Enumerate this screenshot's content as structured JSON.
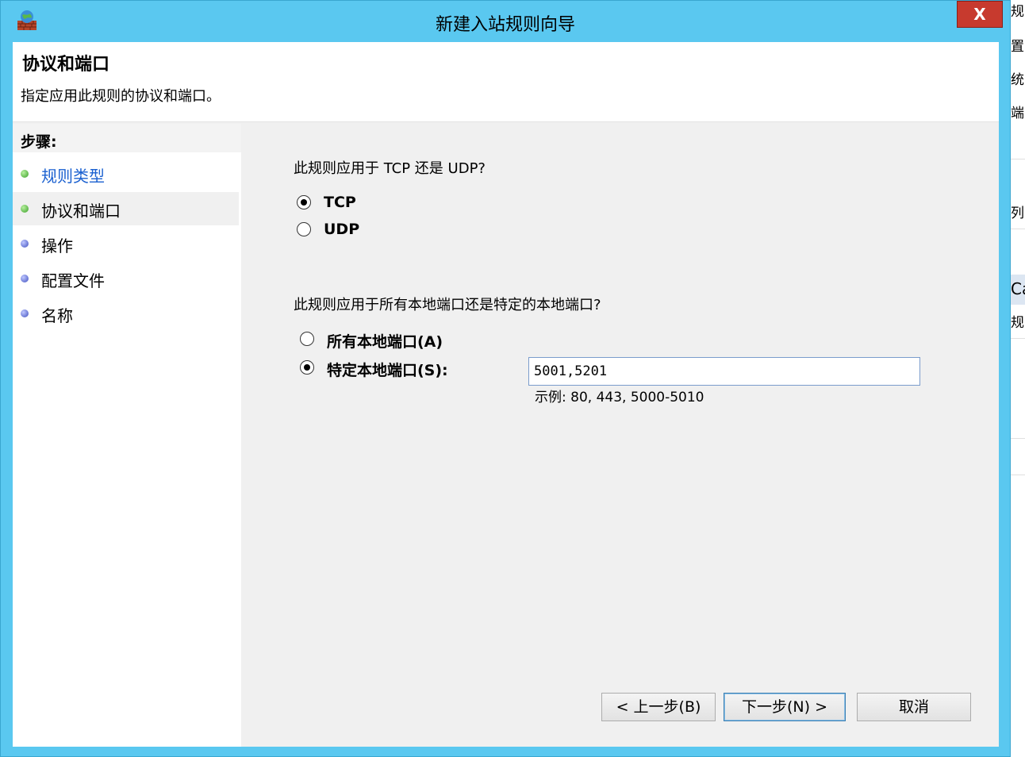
{
  "window": {
    "title": "新建入站规则向导",
    "close_label": "X"
  },
  "header": {
    "title": "协议和端口",
    "description": "指定应用此规则的协议和端口。"
  },
  "steps": {
    "title": "步骤:",
    "items": [
      {
        "label": "规则类型",
        "state": "completed-link",
        "dot_color": "green"
      },
      {
        "label": "协议和端口",
        "state": "current",
        "dot_color": "green"
      },
      {
        "label": "操作",
        "state": "pending",
        "dot_color": "blue"
      },
      {
        "label": "配置文件",
        "state": "pending",
        "dot_color": "blue"
      },
      {
        "label": "名称",
        "state": "pending",
        "dot_color": "blue"
      }
    ]
  },
  "protocol": {
    "question": "此规则应用于 TCP 还是 UDP?",
    "options": [
      {
        "label": "TCP",
        "checked": true
      },
      {
        "label": "UDP",
        "checked": false
      }
    ]
  },
  "ports": {
    "question": "此规则应用于所有本地端口还是特定的本地端口?",
    "options": [
      {
        "label": "所有本地端口(A)",
        "checked": false
      },
      {
        "label": "特定本地端口(S):",
        "checked": true
      }
    ],
    "value": "5001,5201",
    "example": "示例: 80, 443, 5000-5010"
  },
  "buttons": {
    "back": "< 上一步(B)",
    "next": "下一步(N) >",
    "cancel": "取消"
  },
  "background_window": {
    "fragments": [
      "规",
      "置",
      "统",
      "端",
      "列",
      "Ca",
      "规"
    ]
  }
}
